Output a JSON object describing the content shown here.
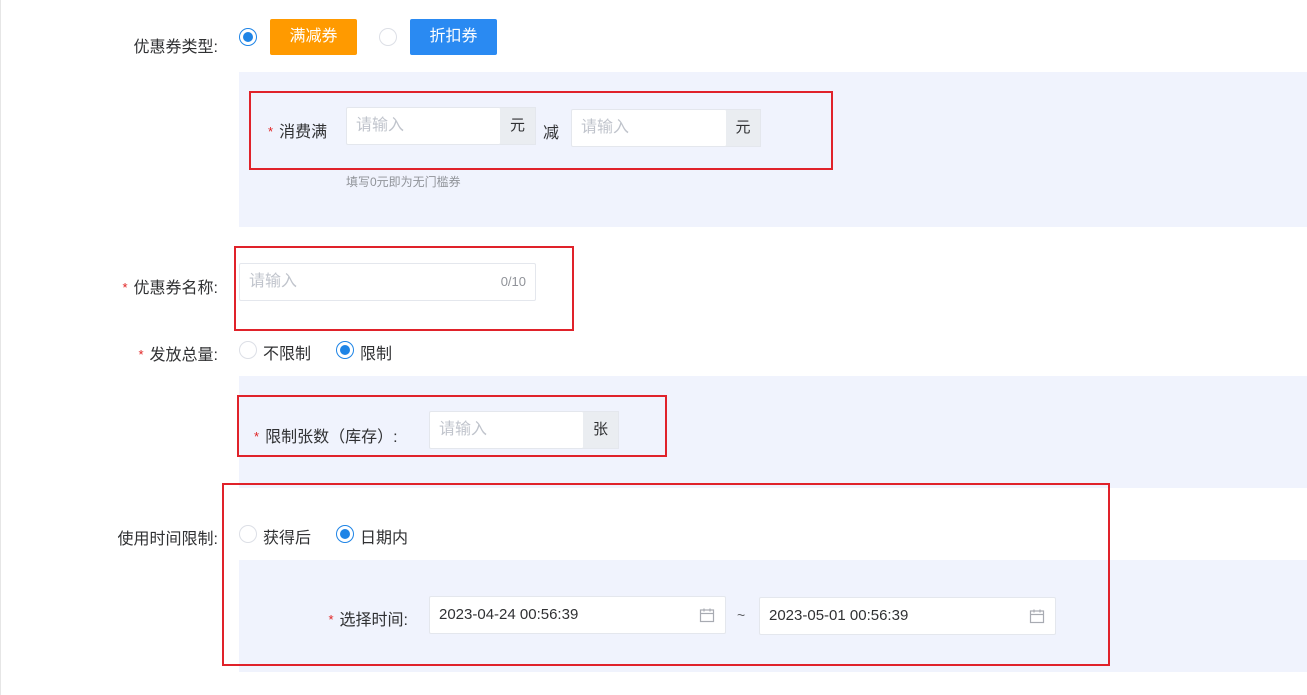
{
  "coupon_type": {
    "label": "优惠券类型:",
    "options": [
      {
        "text": "满减券",
        "selected": true,
        "color": "#ff9a00"
      },
      {
        "text": "折扣券",
        "selected": false,
        "color": "#2a8af2"
      }
    ]
  },
  "threshold": {
    "label": "消费满",
    "min_placeholder": "请输入",
    "min_unit": "元",
    "minus_label": "减",
    "off_placeholder": "请输入",
    "off_unit": "元",
    "hint": "填写0元即为无门槛券"
  },
  "coupon_name": {
    "label": "优惠券名称:",
    "placeholder": "请输入",
    "counter": "0/10"
  },
  "issue_total": {
    "label": "发放总量:",
    "options": [
      {
        "text": "不限制",
        "selected": false
      },
      {
        "text": "限制",
        "selected": true
      }
    ]
  },
  "limit_count": {
    "label": "限制张数（库存）:",
    "placeholder": "请输入",
    "unit": "张"
  },
  "use_time": {
    "label": "使用时间限制:",
    "options": [
      {
        "text": "获得后",
        "selected": false
      },
      {
        "text": "日期内",
        "selected": true
      }
    ]
  },
  "date_range": {
    "label": "选择时间:",
    "start": "2023-04-24 00:56:39",
    "separator": "~",
    "end": "2023-05-01 00:56:39"
  },
  "colors": {
    "accent": "#1e84e6",
    "required": "#e02020",
    "highlight": "#e0222a",
    "panel": "#f0f3fd"
  }
}
